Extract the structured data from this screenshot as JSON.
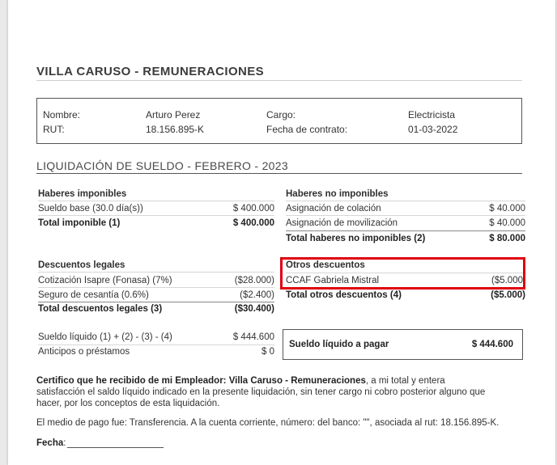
{
  "header": {
    "title": "VILLA CARUSO - REMUNERACIONES"
  },
  "employee": {
    "name_label": "Nombre:",
    "name_value": "Arturo  Perez",
    "rut_label": "RUT:",
    "rut_value": "18.156.895-K",
    "cargo_label": "Cargo:",
    "cargo_value": "Electricista",
    "fecha_contrato_label": "Fecha de contrato:",
    "fecha_contrato_value": "01-03-2022"
  },
  "liquidacion_title": "LIQUIDACIÓN DE SUELDO - FEBRERO - 2023",
  "haberes_imponibles": {
    "heading": "Haberes imponibles",
    "rows": [
      {
        "label": "Sueldo base (30.0 día(s))",
        "value": "$ 400.000"
      }
    ],
    "total_label": "Total imponible (1)",
    "total_value": "$ 400.000"
  },
  "haberes_no_imponibles": {
    "heading": "Haberes no imponibles",
    "rows": [
      {
        "label": "Asignación de colación",
        "value": "$ 40.000"
      },
      {
        "label": "Asignación de movilización",
        "value": "$ 40.000"
      }
    ],
    "total_label": "Total haberes no imponibles (2)",
    "total_value": "$ 80.000"
  },
  "descuentos_legales": {
    "heading": "Descuentos legales",
    "rows": [
      {
        "label": "Cotización Isapre (Fonasa) (7%)",
        "value": "($28.000)"
      },
      {
        "label": "Seguro de cesantía (0.6%)",
        "value": "($2.400)"
      }
    ],
    "total_label": "Total descuentos legales (3)",
    "total_value": "($30.400)"
  },
  "otros_descuentos": {
    "heading": "Otros descuentos",
    "rows": [
      {
        "label": "CCAF Gabriela Mistral",
        "value": "($5.000"
      }
    ],
    "total_label": "Total otros descuentos (4)",
    "total_value": "($5.000)"
  },
  "summary": {
    "liquido_label": "Sueldo líquido (1) + (2) - (3) - (4)",
    "liquido_value": "$ 444.600",
    "anticipos_label": "Anticipos o préstamos",
    "anticipos_value": "$ 0"
  },
  "pay_box": {
    "label": "Sueldo líquido a pagar",
    "value": "$ 444.600"
  },
  "certificate": {
    "bold_prefix": "Certifico que he recibido de mi Empleador: Villa Caruso - Remuneraciones",
    "line1_rest": ", a mi total y entera",
    "line2": "satisfacción el saldo líquido indicado en la presente liquidación, sin tener cargo ni cobro posterior alguno que",
    "line3": "hacer, por los conceptos de esta liquidación.",
    "payment": "El medio de pago fue: Transferencia. A la cuenta corriente, número:  del banco: \"\", asociada al rut: 18.156.895-K.",
    "fecha_label": "Fecha",
    "fecha_colon": ":"
  },
  "colors": {
    "highlight": "#e0000f"
  }
}
